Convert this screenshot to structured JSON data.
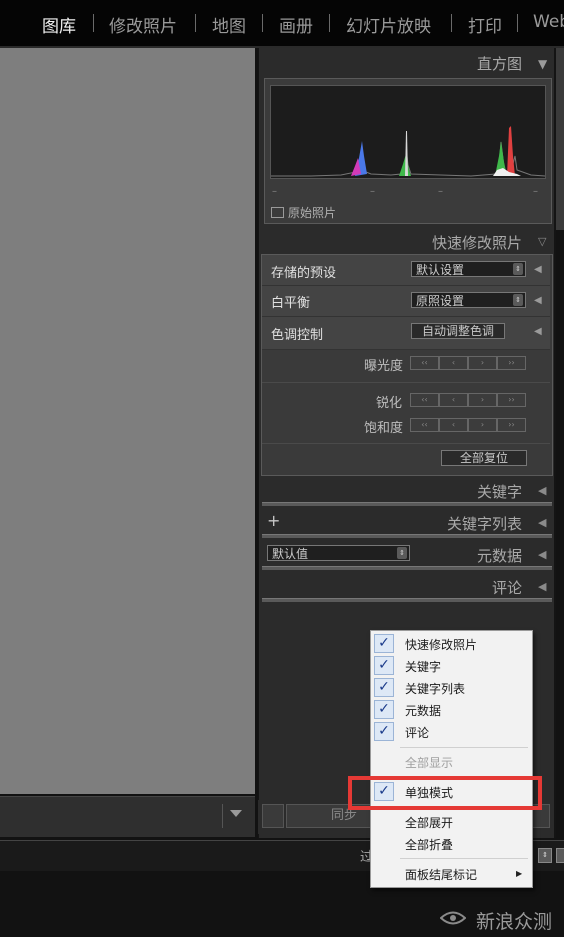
{
  "top_nav": {
    "modules": [
      "图库",
      "修改照片",
      "地图",
      "画册",
      "幻灯片放映",
      "打印",
      "Web"
    ],
    "active": "图库"
  },
  "histogram": {
    "title": "直方图",
    "original_photo_label": "原始照片",
    "tick_labels": [
      "–",
      "–",
      "–",
      "–"
    ]
  },
  "quick_develop": {
    "title": "快速修改照片",
    "saved_preset_label": "存储的预设",
    "saved_preset_value": "默认设置",
    "white_balance_label": "白平衡",
    "white_balance_value": "原照设置",
    "tone_control_label": "色调控制",
    "auto_tone_button": "自动调整色调",
    "exposure_label": "曝光度",
    "clarity_label": "锐化",
    "vibrance_label": "饱和度",
    "reset_all_button": "全部复位"
  },
  "panels": {
    "keywording": "关键字",
    "keyword_list": "关键字列表",
    "metadata": "元数据",
    "metadata_preset": "默认值",
    "comments": "评论"
  },
  "bottom": {
    "sync_button": "同步",
    "status_text": "过"
  },
  "context_menu": {
    "items": [
      {
        "label": "快速修改照片",
        "checked": true
      },
      {
        "label": "关键字",
        "checked": true
      },
      {
        "label": "关键字列表",
        "checked": true
      },
      {
        "label": "元数据",
        "checked": true
      },
      {
        "label": "评论",
        "checked": true
      }
    ],
    "show_all": "全部显示",
    "solo_mode": "单独模式",
    "expand_all": "全部展开",
    "collapse_all": "全部折叠",
    "panel_end_mark": "面板结尾标记"
  },
  "watermark": "新浪众测",
  "colors": {
    "highlight_box": "#e53935",
    "check_blue": "#1a3a8a"
  }
}
